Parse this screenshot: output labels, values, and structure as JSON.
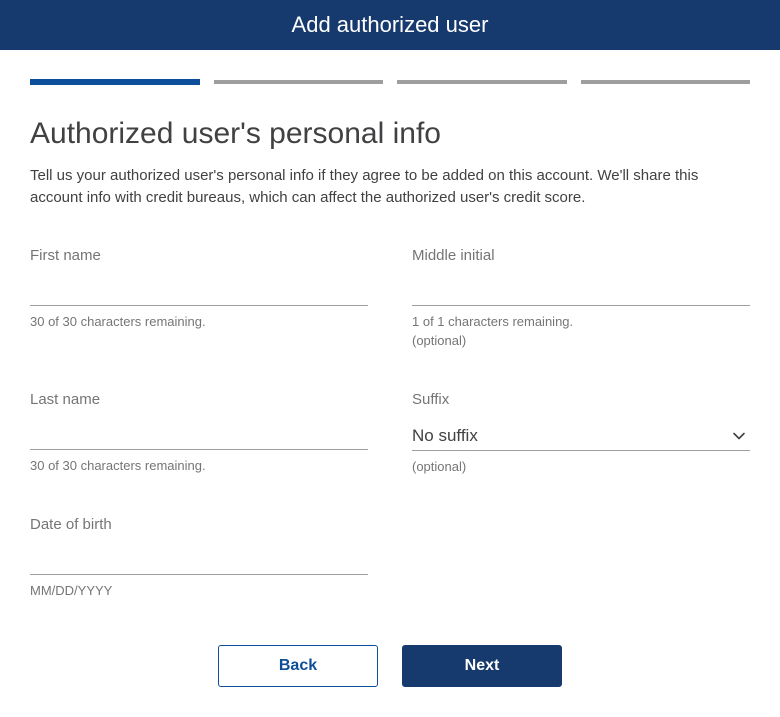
{
  "header": {
    "title": "Add authorized user"
  },
  "progress": {
    "steps": 4,
    "current": 1
  },
  "page": {
    "title": "Authorized user's personal info",
    "description": "Tell us your authorized user's personal info if they agree to be added on this account. We'll share this account info with credit bureaus, which can affect the authorized user's credit score."
  },
  "form": {
    "first_name": {
      "label": "First name",
      "value": "",
      "helper": "30 of 30 characters remaining."
    },
    "middle_initial": {
      "label": "Middle initial",
      "value": "",
      "helper": "1 of 1 characters remaining.",
      "optional_text": "(optional)"
    },
    "last_name": {
      "label": "Last name",
      "value": "",
      "helper": "30 of 30 characters remaining."
    },
    "suffix": {
      "label": "Suffix",
      "value": "No suffix",
      "optional_text": "(optional)"
    },
    "date_of_birth": {
      "label": "Date of birth",
      "value": "",
      "helper": "MM/DD/YYYY"
    }
  },
  "buttons": {
    "back": "Back",
    "next": "Next"
  }
}
